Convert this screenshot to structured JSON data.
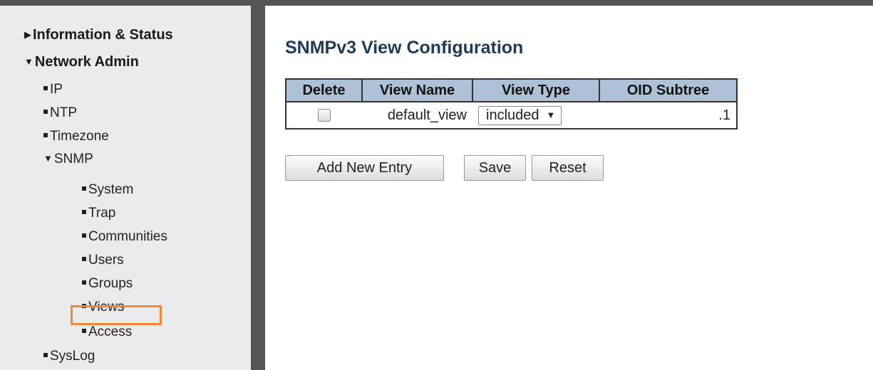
{
  "sidebar": {
    "groups": {
      "info_status": {
        "label": "Information & Status",
        "icon": "triangle-right-icon"
      },
      "network_admin": {
        "label": "Network Admin",
        "icon": "triangle-down-icon"
      }
    },
    "items": {
      "ip": "IP",
      "ntp": "NTP",
      "timezone": "Timezone",
      "snmp": "SNMP",
      "system": "System",
      "trap": "Trap",
      "communities": "Communities",
      "users": "Users",
      "groups": "Groups",
      "views": "Views",
      "access": "Access",
      "syslog": "SysLog"
    },
    "highlight_color": "#f0883b"
  },
  "main": {
    "title": "SNMPv3 View Configuration",
    "table": {
      "headers": [
        "Delete",
        "View Name",
        "View Type",
        "OID Subtree"
      ],
      "rows": [
        {
          "delete_checked": false,
          "view_name": "default_view",
          "view_type": "included",
          "oid_subtree": ".1"
        }
      ]
    },
    "buttons": {
      "add": "Add New Entry",
      "save": "Save",
      "reset": "Reset"
    }
  },
  "colors": {
    "header_bg": "#aec2d7",
    "title": "#1f3b5c",
    "frame": "#555555",
    "sidebar_bg": "#ebebeb"
  }
}
